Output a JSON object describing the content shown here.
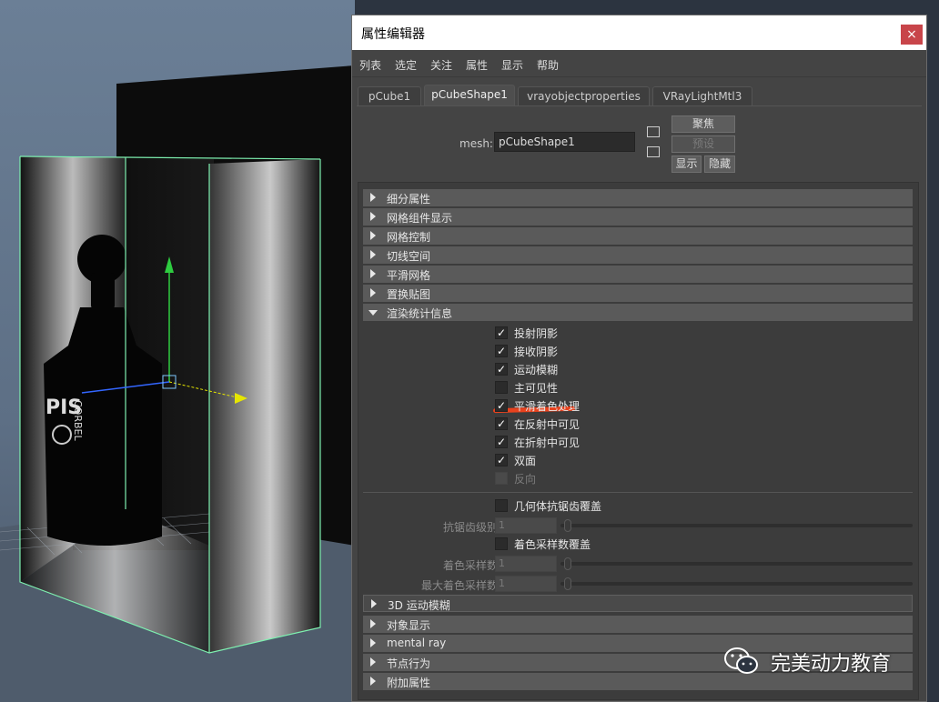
{
  "window": {
    "title": "属性编辑器",
    "close_glyph": "×"
  },
  "menu": [
    "列表",
    "选定",
    "关注",
    "属性",
    "显示",
    "帮助"
  ],
  "tabs": [
    {
      "label": "pCube1"
    },
    {
      "label": "pCubeShape1"
    },
    {
      "label": "vrayobjectproperties"
    },
    {
      "label": "VRayLightMtl3"
    }
  ],
  "node": {
    "label": "mesh:",
    "value": "pCubeShape1"
  },
  "buttons": {
    "focus": "聚焦",
    "presets": "预设",
    "show": "显示",
    "hide": "隐藏"
  },
  "sections_top": [
    "细分属性",
    "网格组件显示",
    "网格控制",
    "切线空间",
    "平滑网格",
    "置换贴图"
  ],
  "render_stats": {
    "title": "渲染统计信息",
    "checks": [
      {
        "label": "投射阴影",
        "checked": true,
        "enabled": true
      },
      {
        "label": "接收阴影",
        "checked": true,
        "enabled": true
      },
      {
        "label": "运动模糊",
        "checked": true,
        "enabled": true
      },
      {
        "label": "主可见性",
        "checked": false,
        "enabled": true
      },
      {
        "label": "平滑着色处理",
        "checked": true,
        "enabled": true
      },
      {
        "label": "在反射中可见",
        "checked": true,
        "enabled": true
      },
      {
        "label": "在折射中可见",
        "checked": true,
        "enabled": true
      },
      {
        "label": "双面",
        "checked": true,
        "enabled": true
      },
      {
        "label": "反向",
        "checked": false,
        "enabled": false
      }
    ],
    "geo_aa_override": "几何体抗锯齿覆盖",
    "aa_level_label": "抗锯齿级别",
    "aa_level_value": "1",
    "shading_override": "着色采样数覆盖",
    "shading_samples_label": "着色采样数",
    "shading_samples_value": "1",
    "max_shading_label": "最大着色采样数",
    "max_shading_value": "1"
  },
  "motion_blur_section": "3D 运动模糊",
  "sections_bottom": [
    "对象显示",
    "mental ray",
    "节点行为",
    "附加属性"
  ],
  "viewport": {
    "bottle_text_1": "PIS",
    "bottle_text_2": "CORBEL"
  },
  "watermark": {
    "text": "完美动力教育"
  },
  "colors": {
    "annotation": "#e8421e",
    "selection_wire": "#7ef0b0"
  }
}
